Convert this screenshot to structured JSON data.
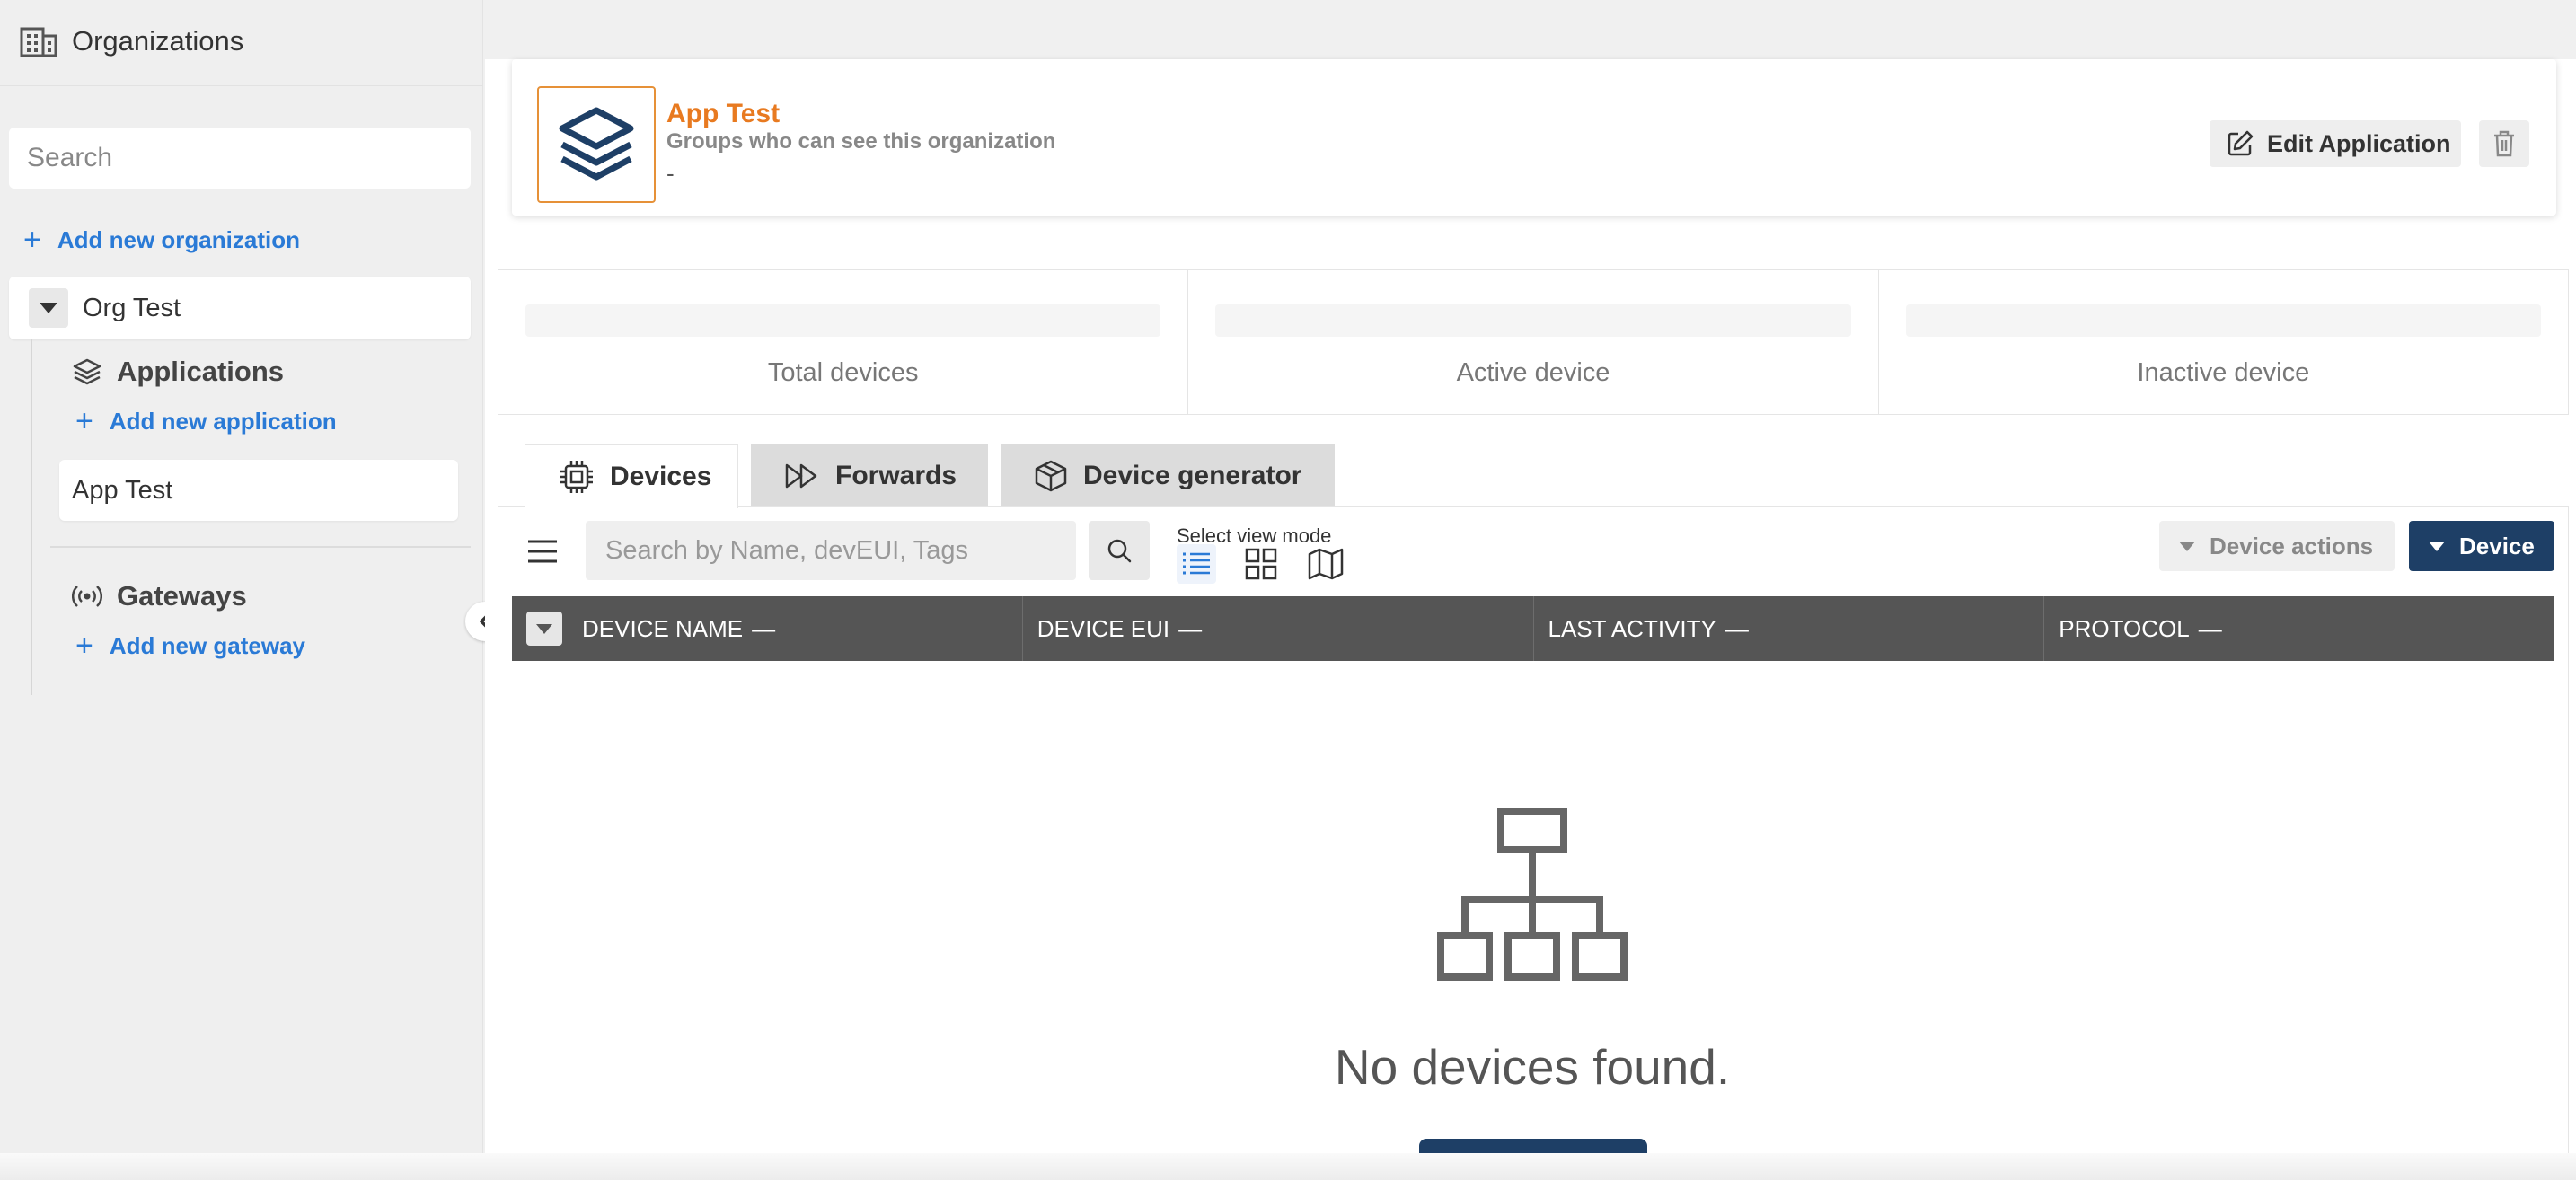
{
  "sidebar": {
    "title": "Organizations",
    "search_placeholder": "Search",
    "add_org_label": "Add new organization",
    "org_name": "Org Test",
    "applications_label": "Applications",
    "add_app_label": "Add new application",
    "app_item": "App Test",
    "gateways_label": "Gateways",
    "add_gateway_label": "Add new gateway"
  },
  "app_card": {
    "name": "App Test",
    "subtitle": "Groups who can see this organization",
    "groups_value": "-",
    "edit_label": "Edit Application"
  },
  "stats": [
    {
      "label": "Total devices"
    },
    {
      "label": "Active device"
    },
    {
      "label": "Inactive device"
    }
  ],
  "tabs": [
    {
      "label": "Devices",
      "icon": "chip-icon",
      "active": true
    },
    {
      "label": "Forwards",
      "icon": "fast-forward-icon",
      "active": false
    },
    {
      "label": "Device generator",
      "icon": "box-icon",
      "active": false
    }
  ],
  "toolbar": {
    "search_placeholder": "Search by Name, devEUI, Tags",
    "view_mode_label": "Select view mode",
    "device_actions_label": "Device actions",
    "device_label": "Device"
  },
  "table": {
    "columns": [
      "DEVICE NAME",
      "DEVICE EUI",
      "LAST ACTIVITY",
      "PROTOCOL"
    ],
    "sort_indicator": "—"
  },
  "empty_state": {
    "message": "No devices found."
  },
  "colors": {
    "accent_orange": "#e87a20",
    "link_blue": "#2a7ad6",
    "primary_navy": "#1e3f66",
    "table_header": "#555555"
  }
}
